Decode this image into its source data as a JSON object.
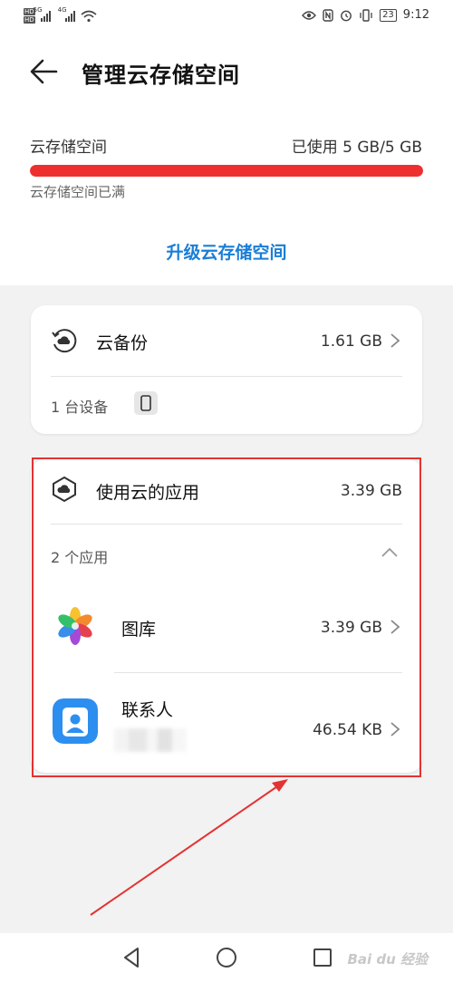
{
  "status_bar": {
    "network_1": "5G",
    "network_2": "4G",
    "battery": "23",
    "time": "9:12"
  },
  "header": {
    "title": "管理云存储空间"
  },
  "storage": {
    "label": "云存储空间",
    "used_text": "已使用 5 GB/5 GB",
    "used_fraction": 1.0,
    "status": "云存储空间已满",
    "bar_color": "#ee2f2f"
  },
  "upgrade": {
    "label": "升级云存储空间",
    "color": "#1a7ed6"
  },
  "backup_card": {
    "title": "云备份",
    "size": "1.61 GB",
    "device_count": "1 台设备",
    "icon": "cloud-backup-icon"
  },
  "apps_card": {
    "title": "使用云的应用",
    "size": "3.39 GB",
    "apps_count": "2 个应用",
    "icon": "cloud-apps-icon",
    "apps": [
      {
        "name": "图库",
        "size": "3.39 GB",
        "icon": "gallery-icon"
      },
      {
        "name": "联系人",
        "size": "46.54 KB",
        "icon": "contacts-icon"
      }
    ]
  },
  "watermark": "Bai du 经验",
  "annotation_color": "#e43232"
}
